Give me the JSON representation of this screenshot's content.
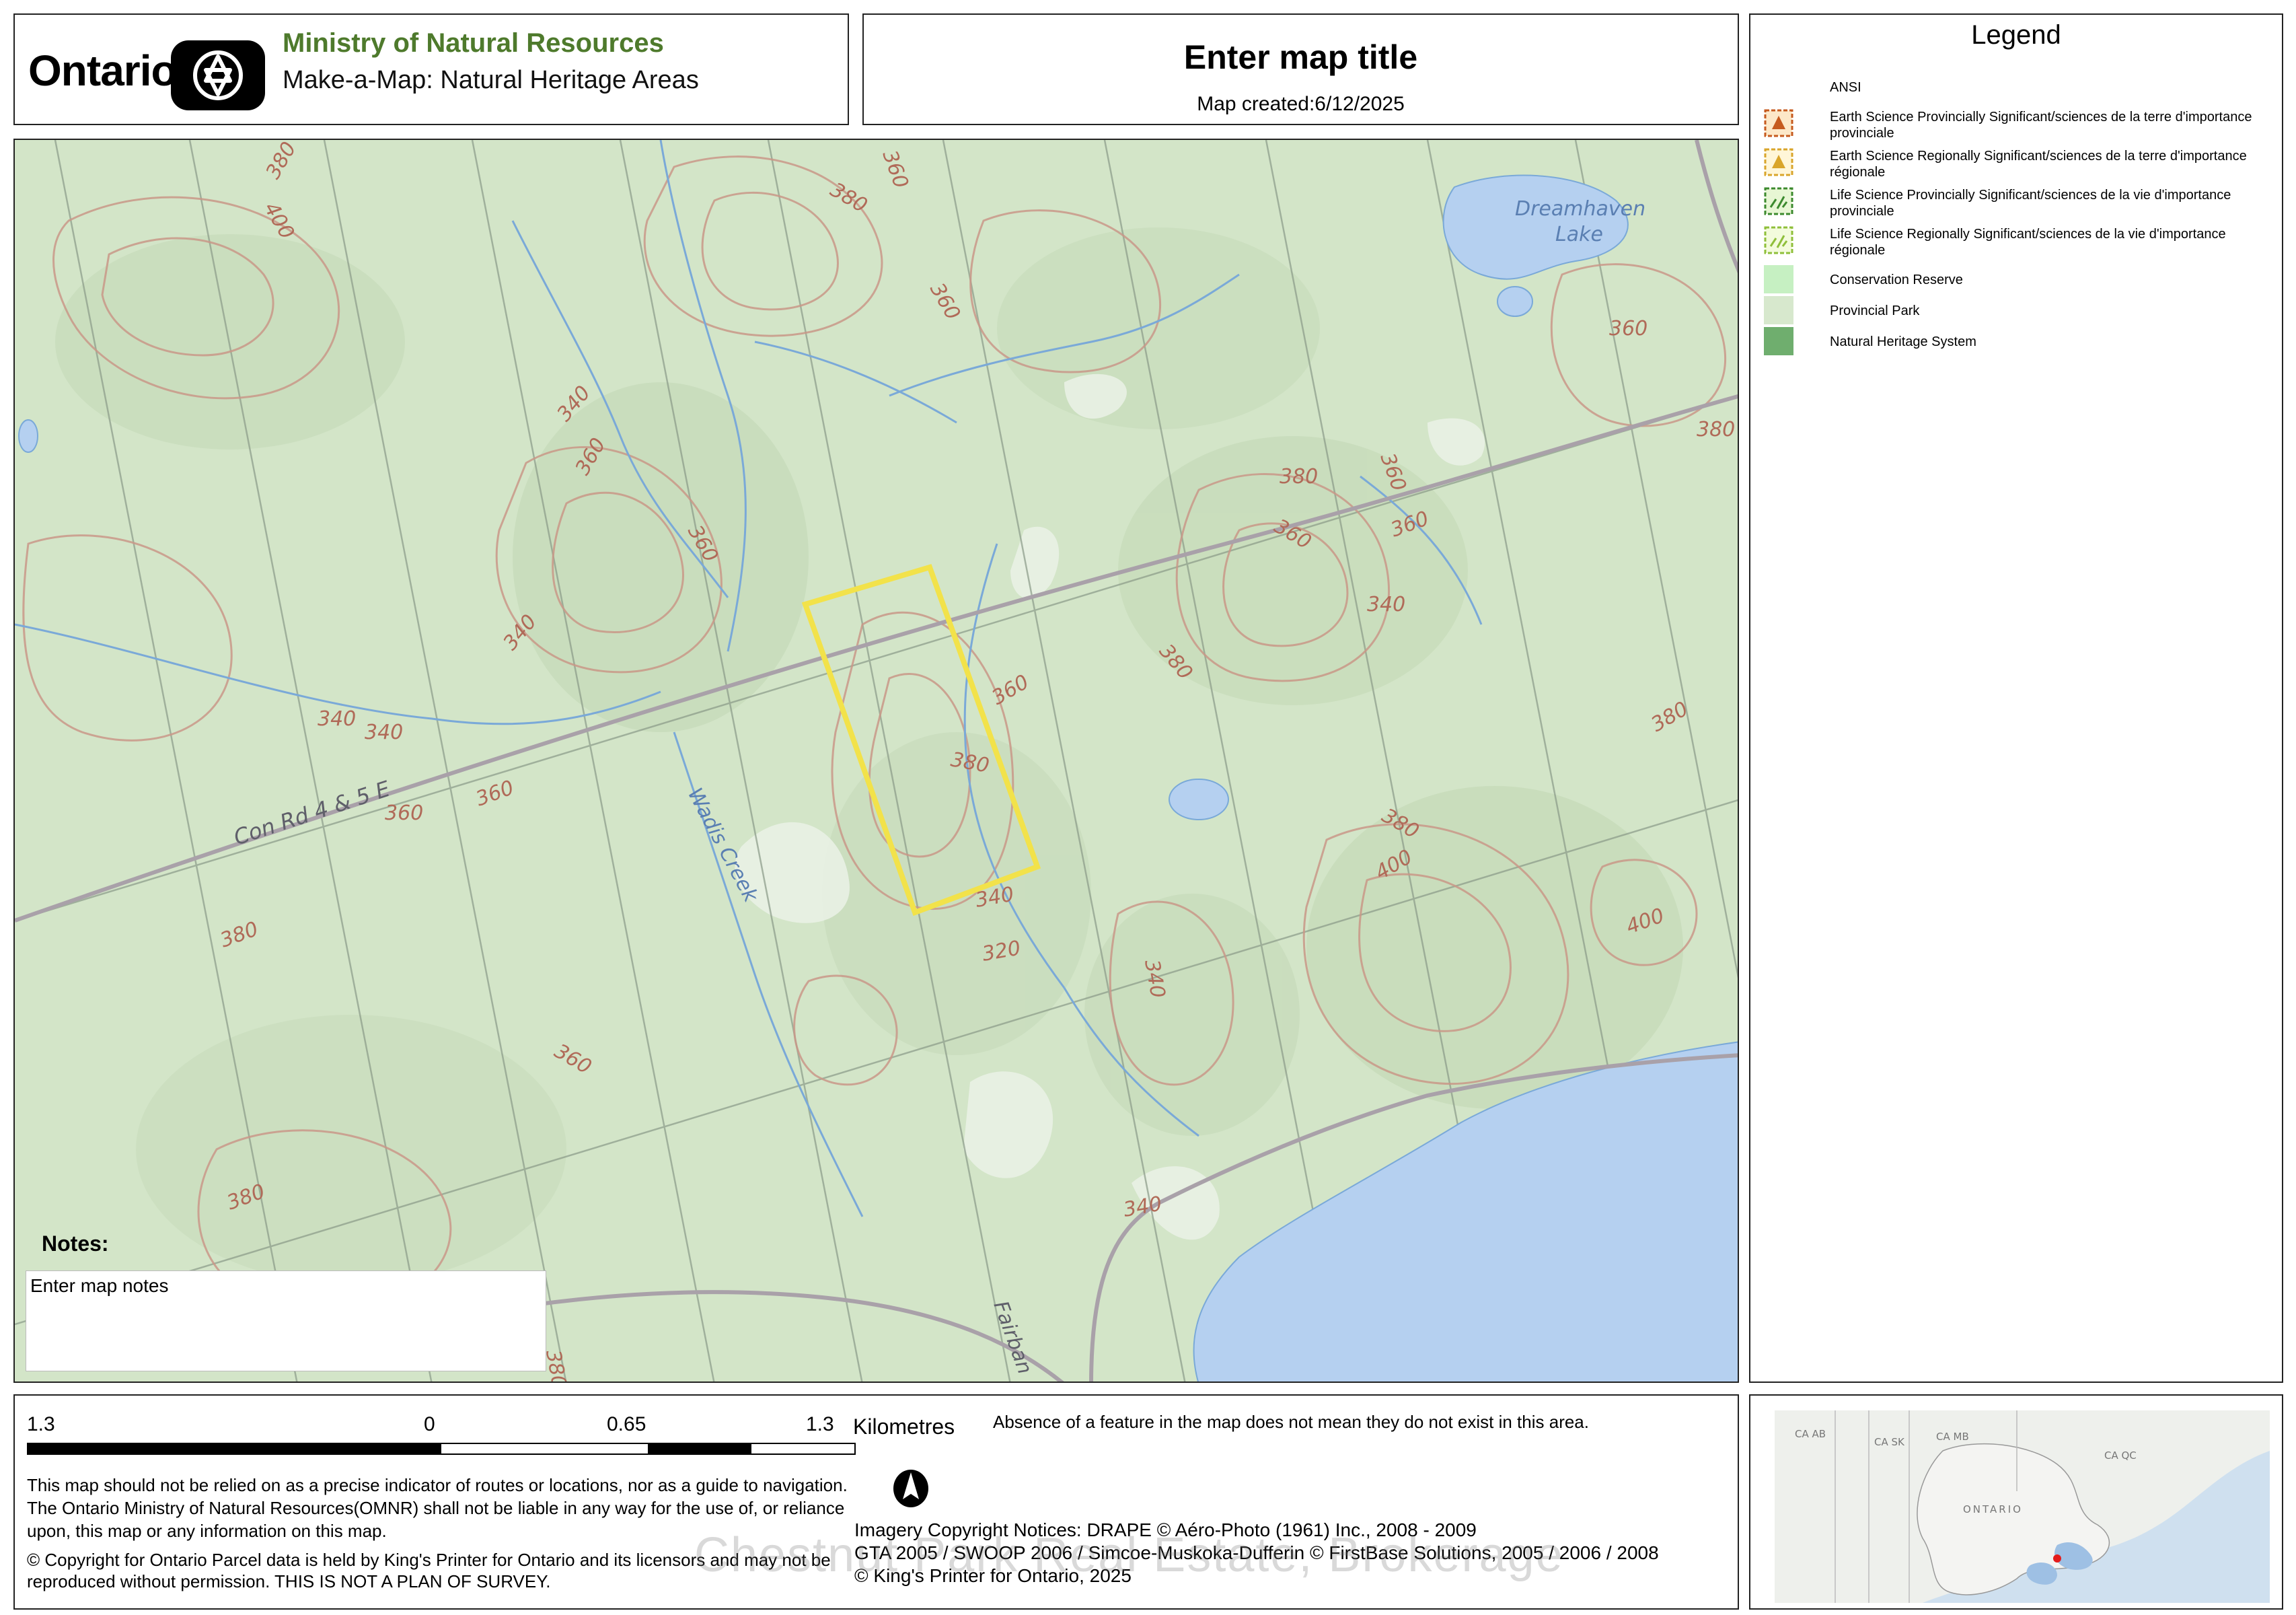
{
  "header": {
    "ontario_word": "Ontario",
    "ministry": "Ministry of Natural Resources",
    "app": "Make-a-Map: Natural Heritage Areas",
    "map_title": "Enter map title",
    "map_created": "Map created:6/12/2025"
  },
  "legend": {
    "title": "Legend",
    "group": "ANSI",
    "items": [
      {
        "label": "Earth Science Provincially Significant/sciences de la terre d'importance provinciale",
        "color": "#c65a1e",
        "icon": "earth-science-provincial-icon"
      },
      {
        "label": "Earth Science Regionally Significant/sciences de la terre d'importance régionale",
        "color": "#d9a52b",
        "icon": "earth-science-regional-icon"
      },
      {
        "label": "Life Science Provincially Significant/sciences de la vie d'importance provinciale",
        "color": "#3c8a2e",
        "icon": "life-science-provincial-icon"
      },
      {
        "label": "Life Science Regionally Significant/sciences de la vie d'importance régionale",
        "color": "#8fbf3a",
        "icon": "life-science-regional-icon"
      },
      {
        "label": "Conservation Reserve",
        "color": "#c6f0c2",
        "icon": "conservation-reserve-swatch"
      },
      {
        "label": "Provincial Park",
        "color": "#d7e8cd",
        "icon": "provincial-park-swatch"
      },
      {
        "label": "Natural Heritage System",
        "color": "#6fae6e",
        "icon": "natural-heritage-system-swatch"
      }
    ]
  },
  "map": {
    "labels": {
      "lake_line1": "Dreamhaven",
      "lake_line2": "Lake",
      "road": "Con Rd 4 & 5 E",
      "creek": "Wadis Creek",
      "road2": "Fairban"
    },
    "contours": [
      "380",
      "400",
      "380",
      "360",
      "360",
      "340",
      "360",
      "360",
      "340",
      "360",
      "380",
      "360",
      "380",
      "360",
      "340",
      "360",
      "380",
      "360",
      "340",
      "360",
      "340",
      "360",
      "380",
      "380",
      "400",
      "380",
      "400",
      "340",
      "340",
      "320",
      "380",
      "360",
      "380",
      "340",
      "380"
    ],
    "colors": {
      "land": "#d3e5c8",
      "water": "#b5d0f0",
      "contour": "#c99888",
      "stream": "#7aa9d8",
      "parcel": "#f2e24a",
      "grid": "#8a9a88"
    }
  },
  "notes": {
    "title": "Notes:",
    "placeholder": "Enter map notes"
  },
  "footer": {
    "scale_labels": [
      "1.3",
      "0",
      "0.65",
      "1.3"
    ],
    "units": "Kilometres",
    "absence": "Absence of a feature in the map does not mean they do not exist in this area.",
    "disclaimer": "This map should not be relied on as a precise indicator of routes or locations, nor as a guide to navigation. The Ontario Ministry of Natural Resources(OMNR) shall not be liable in any way for the use of, or reliance upon, this map or any information on this map.",
    "copyright": "© Copyright for Ontario Parcel data is held by King's Printer for Ontario and its licensors and may not be reproduced without permission. THIS IS NOT A PLAN OF SURVEY.",
    "imagery1": "Imagery Copyright Notices: DRAPE © Aéro-Photo (1961) Inc., 2008 - 2009",
    "imagery2": "GTA 2005 / SWOOP 2006 / Simcoe-Muskoka-Dufferin © FirstBase Solutions, 2005 / 2006 / 2008",
    "imagery3": "© King's Printer for Ontario,  2025",
    "watermark": "Chestnut Park Real Estate, Brokerage"
  },
  "inset": {
    "labels": [
      "CA AB",
      "CA SK",
      "CA MB",
      "CA QC",
      "ONTARIO"
    ]
  }
}
